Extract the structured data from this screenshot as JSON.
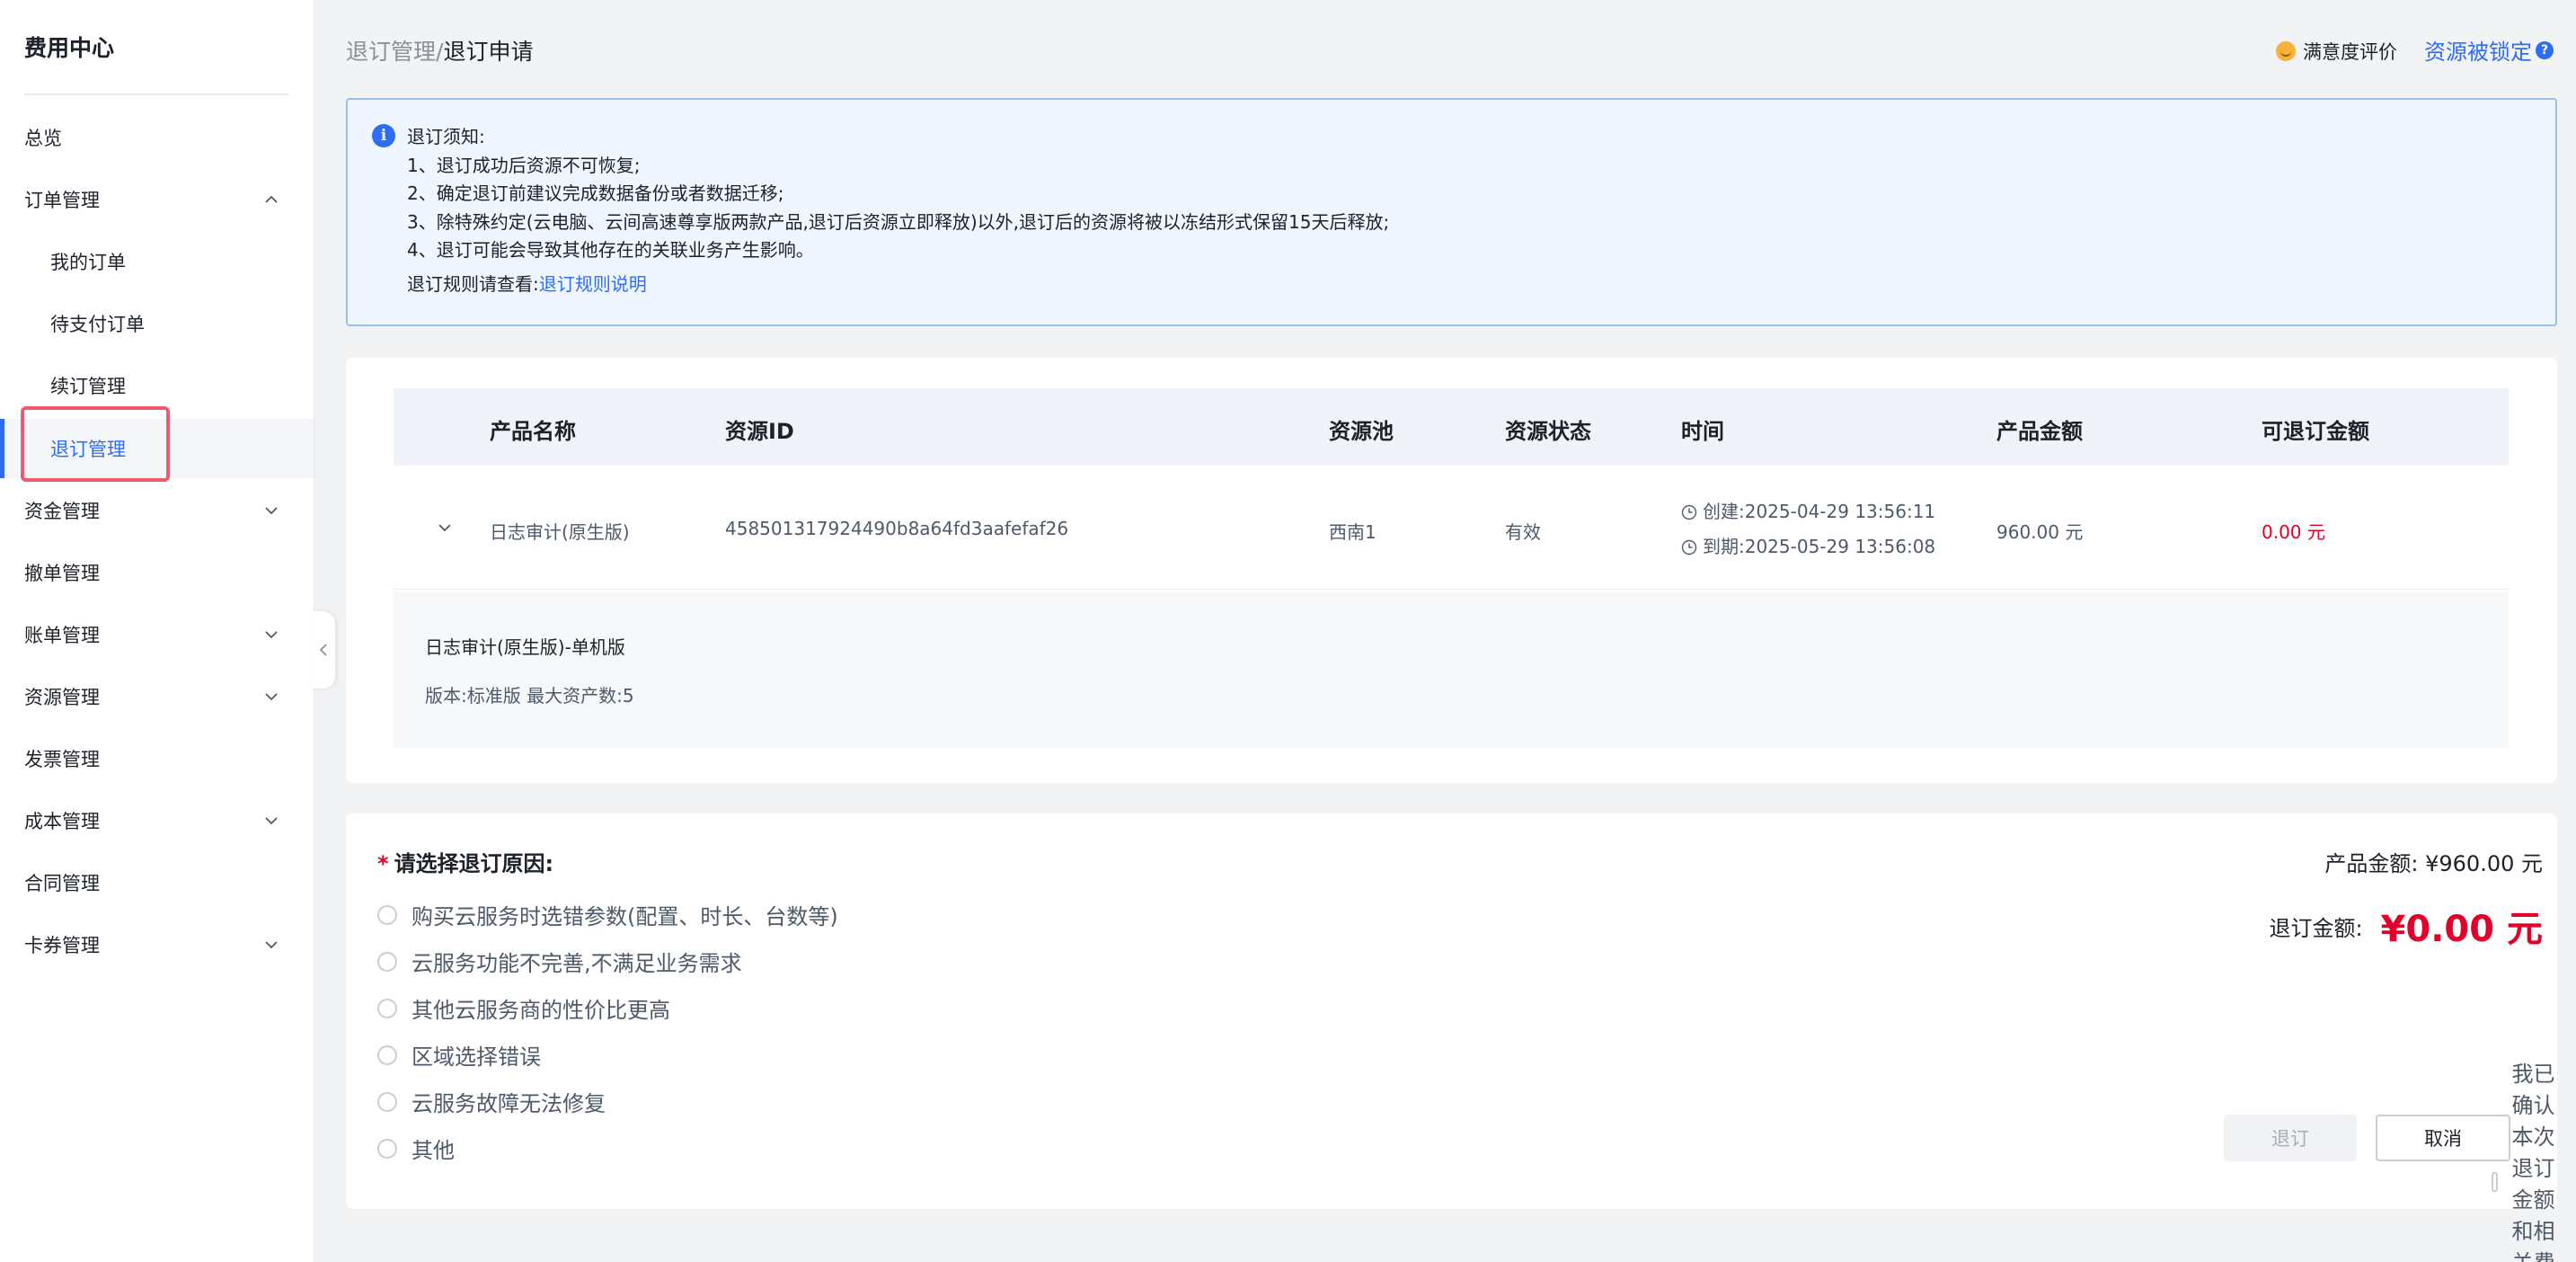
{
  "sidebar": {
    "title": "费用中心",
    "items": [
      {
        "label": "总览"
      },
      {
        "label": "订单管理"
      },
      {
        "label": "我的订单"
      },
      {
        "label": "待支付订单"
      },
      {
        "label": "续订管理"
      },
      {
        "label": "退订管理"
      },
      {
        "label": "资金管理"
      },
      {
        "label": "撤单管理"
      },
      {
        "label": "账单管理"
      },
      {
        "label": "资源管理"
      },
      {
        "label": "发票管理"
      },
      {
        "label": "成本管理"
      },
      {
        "label": "合同管理"
      },
      {
        "label": "卡券管理"
      }
    ]
  },
  "header": {
    "breadcrumb_parent": "退订管理",
    "breadcrumb_sep": "/",
    "breadcrumb_current": "退订申请",
    "satisfaction": "满意度评价",
    "locked": "资源被锁定",
    "help_glyph": "?"
  },
  "notice": {
    "title": "退订须知:",
    "lines": [
      "1、退订成功后资源不可恢复;",
      "2、确定退订前建议完成数据备份或者数据迁移;",
      "3、除特殊约定(云电脑、云间高速尊享版两款产品,退订后资源立即释放)以外,退订后的资源将被以冻结形式保留15天后释放;",
      "4、退订可能会导致其他存在的关联业务产生影响。"
    ],
    "rules_prefix": "退订规则请查看:",
    "rules_link": "退订规则说明"
  },
  "table": {
    "headers": [
      "产品名称",
      "资源ID",
      "资源池",
      "资源状态",
      "时间",
      "产品金额",
      "可退订金额"
    ],
    "row": {
      "product": "日志审计(原生版)",
      "resource_id": "458501317924490b8a64fd3aafefaf26",
      "pool": "西南1",
      "status": "有效",
      "created": "创建:2025-04-29 13:56:11",
      "expires": "到期:2025-05-29 13:56:08",
      "amount": "960.00 元",
      "refundable": "0.00 元"
    },
    "detail": {
      "title": "日志审计(原生版)-单机版",
      "meta": "版本:标准版 最大资产数:5"
    }
  },
  "reason": {
    "required_mark": "*",
    "title": "请选择退订原因:",
    "options": [
      "购买云服务时选错参数(配置、时长、台数等)",
      "云服务功能不完善,不满足业务需求",
      "其他云服务商的性价比更高",
      "区域选择错误",
      "云服务故障无法修复",
      "其他"
    ]
  },
  "summary": {
    "product_amount_label": "产品金额:",
    "product_amount": "¥960.00 元",
    "refund_label": "退订金额:",
    "refund_amount": "¥0.00 元",
    "confirm_text": "我已确认本次退订金额和相关费用",
    "refund_button": "退订",
    "cancel_button": "取消"
  },
  "colors": {
    "accent": "#2f6cf6",
    "danger": "#e0002a",
    "highlight": "#f05a6e"
  }
}
